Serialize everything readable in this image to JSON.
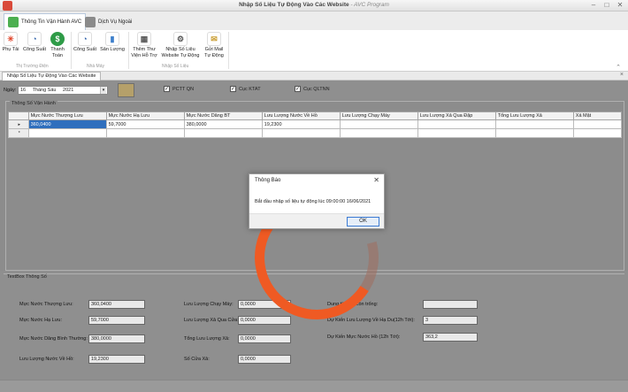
{
  "window": {
    "title": "Nhập Số Liệu Tự Động Vào Các Website",
    "program": " - AVC Program"
  },
  "ribbon_tabs": [
    {
      "label": "Thông Tin Vận Hành AVC"
    },
    {
      "label": "Dịch Vụ Ngoài"
    }
  ],
  "ribbon": {
    "buttons": [
      {
        "label": "Phụ Tải",
        "icon": "network-icon"
      },
      {
        "label": "Công Suất",
        "icon": "gauge-icon"
      },
      {
        "label": "Thanh Toán",
        "icon": "dollar-icon"
      },
      {
        "label": "Công Suất",
        "icon": "gauge-icon"
      },
      {
        "label": "Sản Lượng",
        "icon": "bar-chart-icon"
      },
      {
        "label": "Thêm Thư Viện Hỗ Trợ",
        "icon": "library-icon"
      },
      {
        "label": "Nhập Số Liệu Website Tự Động",
        "icon": "gears-icon"
      },
      {
        "label": "Gửi Mail Tự Động",
        "icon": "mail-icon"
      }
    ],
    "groups": [
      "Thị Trường Điện",
      "Nhà Máy",
      "Nhập Số Liệu"
    ]
  },
  "doc_tab": {
    "label": "Nhập Số Liệu Tự Động Vào Các Website"
  },
  "toolbar": {
    "date_label": "Ngày:",
    "date_day": "16",
    "date_month": "Tháng Sáu",
    "date_year": "2021",
    "checks": [
      {
        "label": "PCTT QN",
        "checked": true
      },
      {
        "label": "Cục KTAT",
        "checked": true
      },
      {
        "label": "Cục QLTNN",
        "checked": true
      }
    ]
  },
  "grid": {
    "legend": "Thông Số Vận Hành",
    "columns": [
      "Mực Nước Thượng Lưu",
      "Mực Nước Hạ Lưu",
      "Mực Nước Dâng BT",
      "Lưu Lượng Nước Về Hồ",
      "Lưu Lượng Chạy Máy",
      "Lưu Lượng Xả Qua Đập",
      "Tổng Lưu Lượng Xả",
      "Xả Mặt"
    ],
    "rows": [
      {
        "marker": "▸",
        "cells": [
          "360,0400",
          "59,7000",
          "380,0000",
          "19,2300",
          "",
          "",
          "",
          ""
        ]
      },
      {
        "marker": "*",
        "cells": [
          "",
          "",
          "",
          "",
          "",
          "",
          "",
          ""
        ]
      }
    ]
  },
  "textbox": {
    "legend": "TextBox Thông Số",
    "fields": [
      {
        "label": "Mực Nước Thượng Lưu:",
        "value": "360,0400"
      },
      {
        "label": "Mực Nước Hạ Lưu:",
        "value": "59,7000"
      },
      {
        "label": "Mực Nước Dâng Bình Thường:",
        "value": "380,0000"
      },
      {
        "label": "Lưu Lượng Nước Về Hồ:",
        "value": "19,2300"
      },
      {
        "label": "Lưu Lượng Chạy Máy:",
        "value": "0,0000"
      },
      {
        "label": "Lưu Lượng Xả Qua Cửa:",
        "value": "0,0000"
      },
      {
        "label": "Tổng Lưu Lượng Xả:",
        "value": "0,0000"
      },
      {
        "label": "Số Cửa Xả:",
        "value": "0,0000"
      },
      {
        "label": "Dung tích hồ còn trống:",
        "value": ""
      },
      {
        "label": "Dự Kiến Lưu Lượng Về Hạ Du(12h Tới):",
        "value": "3"
      },
      {
        "label": "Dự Kiến Mực Nước Hồ (12h Tới):",
        "value": "363,2"
      }
    ]
  },
  "dialog": {
    "title": "Thông Báo",
    "message": "Bắt đầu nhập số liệu tự động lúc 09:00:00 16/06/2021",
    "ok_label": "OK"
  },
  "colors": {
    "accent": "#2f6fbd",
    "spinner": "#ef5a23"
  }
}
